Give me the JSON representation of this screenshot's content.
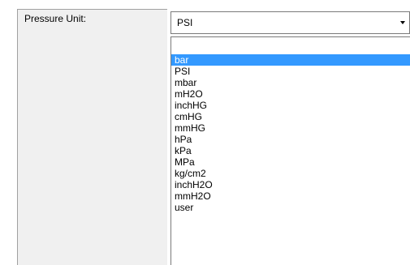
{
  "field": {
    "label": "Pressure Unit:"
  },
  "combo": {
    "selected": "PSI",
    "arrow_icon": "chevron-down-icon"
  },
  "dropdown": {
    "highlighted_index": 0,
    "items": [
      "bar",
      "PSI",
      "mbar",
      "mH2O",
      "inchHG",
      "cmHG",
      "mmHG",
      "hPa",
      "kPa",
      "MPa",
      "kg/cm2",
      "inchH2O",
      "mmH2O",
      "user"
    ]
  },
  "colors": {
    "selection": "#3399ff",
    "panel": "#f0f0f0",
    "border": "#7a7a7a"
  }
}
